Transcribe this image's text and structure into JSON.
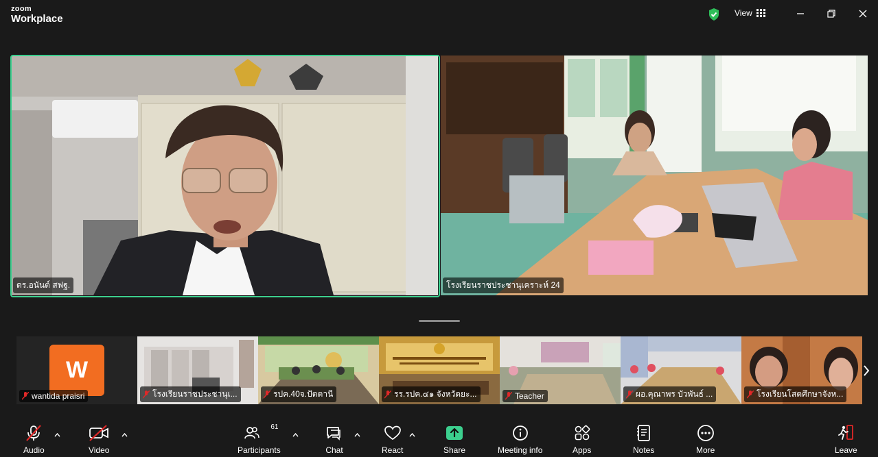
{
  "app": {
    "logo_top": "zoom",
    "logo_bottom": "Workplace"
  },
  "titlebar": {
    "view_label": "View"
  },
  "main_videos": [
    {
      "name": "ดร.อนันต์ สฟฐ."
    },
    {
      "name": "โรงเรียนราชประชานุเคราะห์ 24"
    }
  ],
  "thumbnails": [
    {
      "name": "wantida praisri",
      "avatar_letter": "W"
    },
    {
      "name": "โรงเรียนราชประชานุเ..."
    },
    {
      "name": "รปค.40จ.ปัตตานี"
    },
    {
      "name": "รร.รปค.๔๑ จังหวัดยะ..."
    },
    {
      "name": "Teacher"
    },
    {
      "name": "ผอ.คุณาพร บัวพันธ์ ..."
    },
    {
      "name": "โรงเรียนโสตศึกษาจังห..."
    }
  ],
  "toolbar": {
    "audio": "Audio",
    "video": "Video",
    "participants": "Participants",
    "participants_count": "61",
    "chat": "Chat",
    "react": "React",
    "share": "Share",
    "meeting_info": "Meeting info",
    "apps": "Apps",
    "notes": "Notes",
    "more": "More",
    "leave": "Leave"
  },
  "colors": {
    "speaker_border": "#3ccf8e",
    "share_green": "#3ccf8e",
    "mute_red": "#e02828",
    "avatar_orange": "#f26d21"
  }
}
